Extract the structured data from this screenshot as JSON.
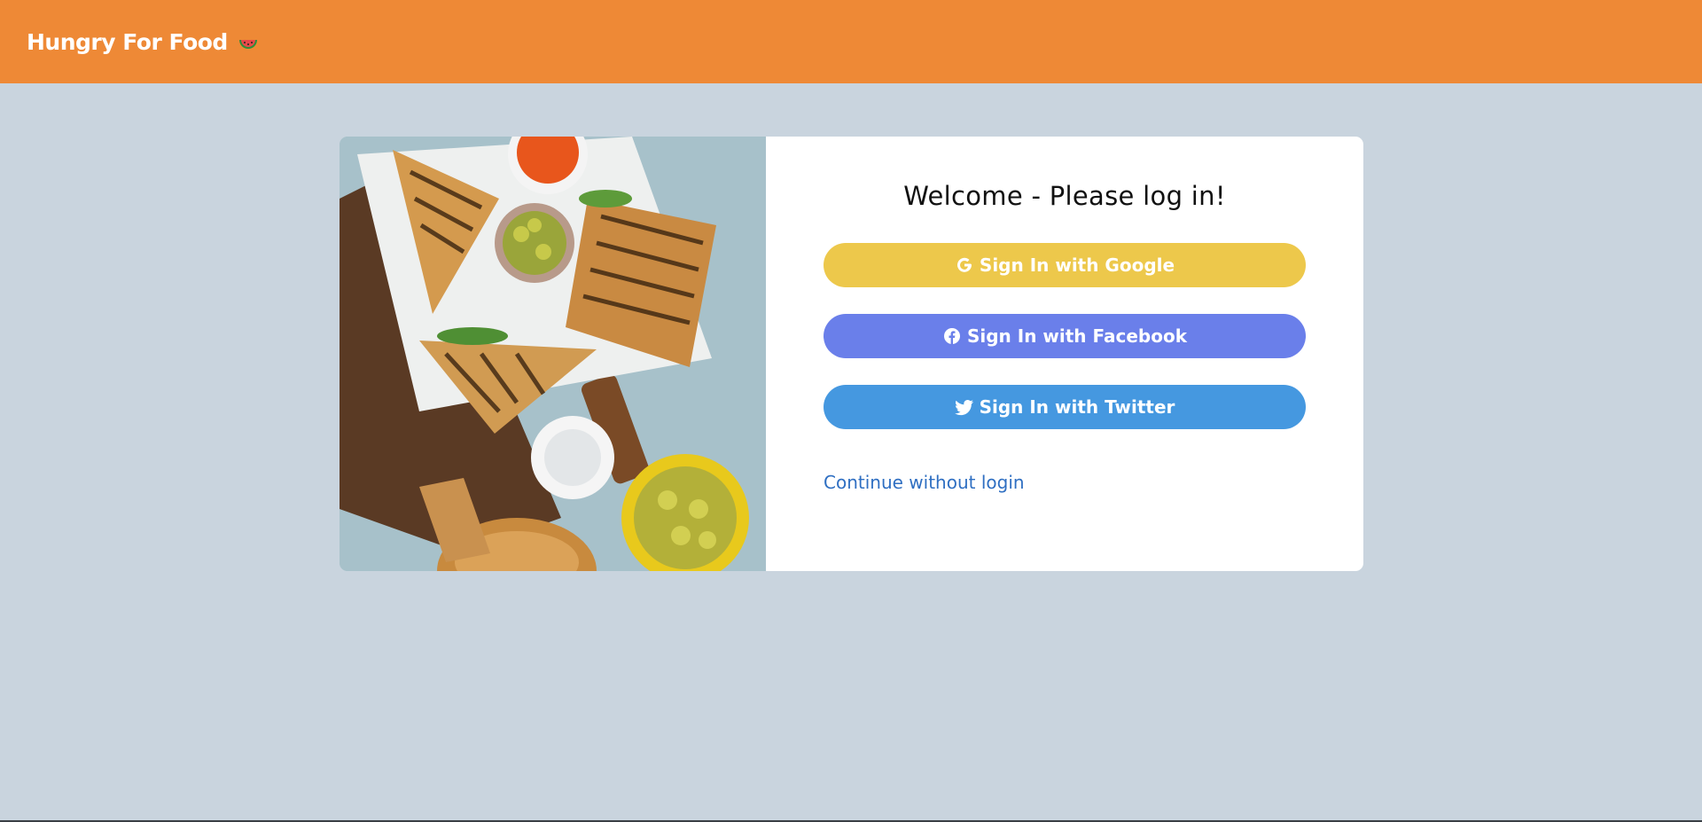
{
  "navbar": {
    "brand": "Hungry For Food",
    "brand_icon": "watermelon-icon",
    "background": "#ee8936"
  },
  "login": {
    "title": "Welcome - Please log in!",
    "buttons": [
      {
        "label": "Sign In with Google",
        "icon": "google-icon",
        "color": "#edc84b"
      },
      {
        "label": "Sign In with Facebook",
        "icon": "facebook-icon",
        "color": "#6a7fea"
      },
      {
        "label": "Sign In with Twitter",
        "icon": "twitter-icon",
        "color": "#4598e0"
      }
    ],
    "continue_label": "Continue without login",
    "link_color": "#2f6fc2"
  },
  "page": {
    "background": "#c9d4de"
  }
}
